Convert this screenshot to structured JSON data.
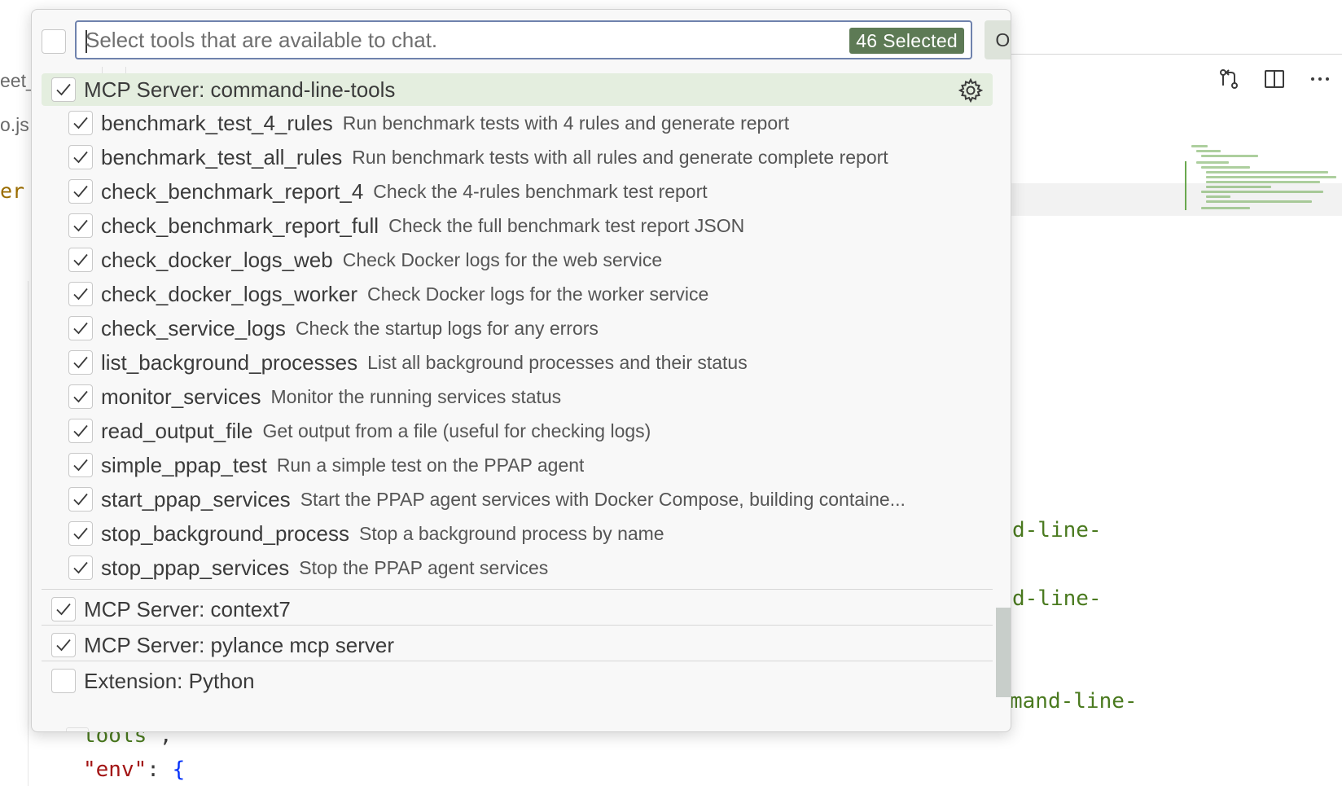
{
  "background": {
    "left_tabs": [
      "eet_",
      "o.js"
    ],
    "left_code": "er",
    "code_fragments": [
      "d-line-",
      "d-line-",
      "mand-line-"
    ],
    "code_bottom": {
      "line1": "tools",
      "line1_punct": "\",",
      "key": "\"env\"",
      "colon": ": ",
      "brace": "{"
    },
    "toolbar_icons": [
      "source-control-compare-icon",
      "split-editor-icon",
      "more-actions-icon"
    ]
  },
  "quickpick": {
    "search": {
      "placeholder": "Select tools that are available to chat.",
      "value": ""
    },
    "selected_badge": "46 Selected",
    "ok_label": "OK",
    "groups": [
      {
        "label": "MCP Server: command-line-tools",
        "checked": true,
        "active": true,
        "tools": [
          {
            "name": "benchmark_test_4_rules",
            "description": "Run benchmark tests with 4 rules and generate report",
            "checked": true
          },
          {
            "name": "benchmark_test_all_rules",
            "description": "Run benchmark tests with all rules and generate complete report",
            "checked": true
          },
          {
            "name": "check_benchmark_report_4",
            "description": "Check the 4-rules benchmark test report",
            "checked": true
          },
          {
            "name": "check_benchmark_report_full",
            "description": "Check the full benchmark test report JSON",
            "checked": true
          },
          {
            "name": "check_docker_logs_web",
            "description": "Check Docker logs for the web service",
            "checked": true
          },
          {
            "name": "check_docker_logs_worker",
            "description": "Check Docker logs for the worker service",
            "checked": true
          },
          {
            "name": "check_service_logs",
            "description": "Check the startup logs for any errors",
            "checked": true
          },
          {
            "name": "list_background_processes",
            "description": "List all background processes and their status",
            "checked": true
          },
          {
            "name": "monitor_services",
            "description": "Monitor the running services status",
            "checked": true
          },
          {
            "name": "read_output_file",
            "description": "Get output from a file (useful for checking logs)",
            "checked": true
          },
          {
            "name": "simple_ppap_test",
            "description": "Run a simple test on the PPAP agent",
            "checked": true
          },
          {
            "name": "start_ppap_services",
            "description": "Start the PPAP agent services with Docker Compose, building containe...",
            "checked": true
          },
          {
            "name": "stop_background_process",
            "description": "Stop a background process by name",
            "checked": true
          },
          {
            "name": "stop_ppap_services",
            "description": "Stop the PPAP agent services",
            "checked": true
          }
        ]
      },
      {
        "label": "MCP Server: context7",
        "checked": true,
        "active": false,
        "tools": []
      },
      {
        "label": "MCP Server: pylance mcp server",
        "checked": true,
        "active": false,
        "tools": []
      },
      {
        "label": "Extension: Python",
        "checked": false,
        "active": false,
        "tools": []
      }
    ]
  },
  "colors": {
    "badge_bg": "#5d7a55",
    "active_row_bg": "#e4eedf",
    "search_border": "#6f82ad",
    "ok_bg": "#dde3da",
    "code_string": "#4a7a1f"
  }
}
